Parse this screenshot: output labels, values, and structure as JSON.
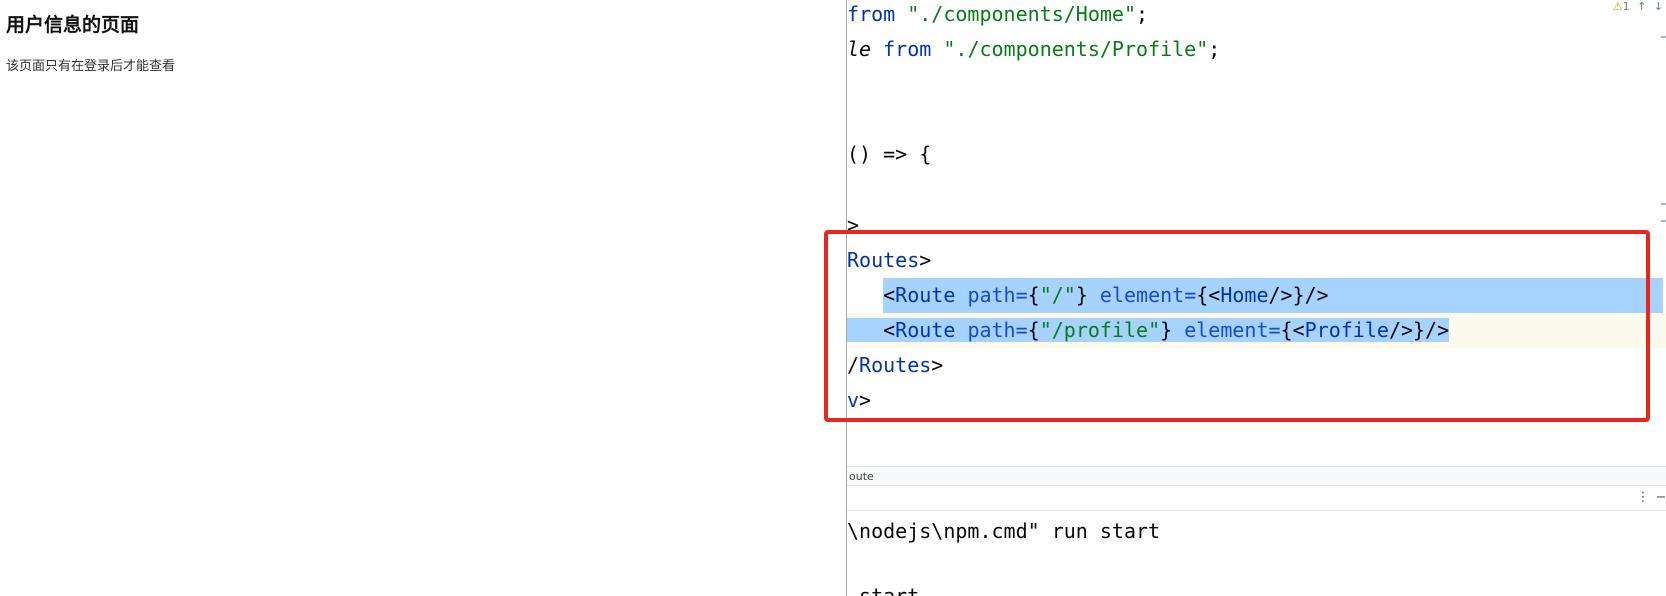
{
  "browser_page": {
    "title": "用户信息的页面",
    "description": "该页面只有在登录后才能查看"
  },
  "ide": {
    "inspection_widget": {
      "warning_icon": "warning-triangle-icon",
      "warning_count": "1",
      "up_icon": "arrow-up-icon",
      "down_icon": "arrow-down-icon"
    },
    "code": {
      "line1": {
        "kw": "from",
        "sp": " ",
        "str": "\"./components/Home\"",
        "end": ";"
      },
      "line2": {
        "ident": "le",
        "sp1": " ",
        "kw": "from",
        "sp2": " ",
        "str": "\"./components/Profile\"",
        "end": ";"
      },
      "line3": {
        "text": "() => {"
      },
      "line4": {
        "text": ">"
      },
      "line5": {
        "tag": "Routes",
        "end": ">"
      },
      "line6": {
        "indent": "   ",
        "open": "<",
        "tag": "Route",
        "sp1": " ",
        "attr1": "path=",
        "b1": "{",
        "str1": "\"/\"",
        "b2": "}",
        "sp2": " ",
        "attr2": "element=",
        "b3": "{<",
        "comp": "Home",
        "close": "/>}/>"
      },
      "line7": {
        "indent": "   ",
        "open": "<",
        "tag": "Route",
        "sp1": " ",
        "attr1": "path=",
        "b1": "{",
        "str1": "\"/profile\"",
        "b2": "}",
        "sp2": " ",
        "attr2": "element=",
        "b3": "{<",
        "comp": "Profile",
        "close": "/>}/>"
      },
      "line8": {
        "slash": "/",
        "tag": "Routes",
        "end": ">"
      },
      "line9": {
        "tag": "v",
        "end": ">"
      }
    },
    "breadcrumb": "oute",
    "terminal": {
      "menu_icon": "more-vertical-icon",
      "minimize_icon": "minimize-icon",
      "line1": "\\nodejs\\npm.cmd\" run start",
      "line2": " start"
    },
    "colors": {
      "highlight_border": "#e8261f",
      "selection": "#a6d2ff"
    }
  }
}
